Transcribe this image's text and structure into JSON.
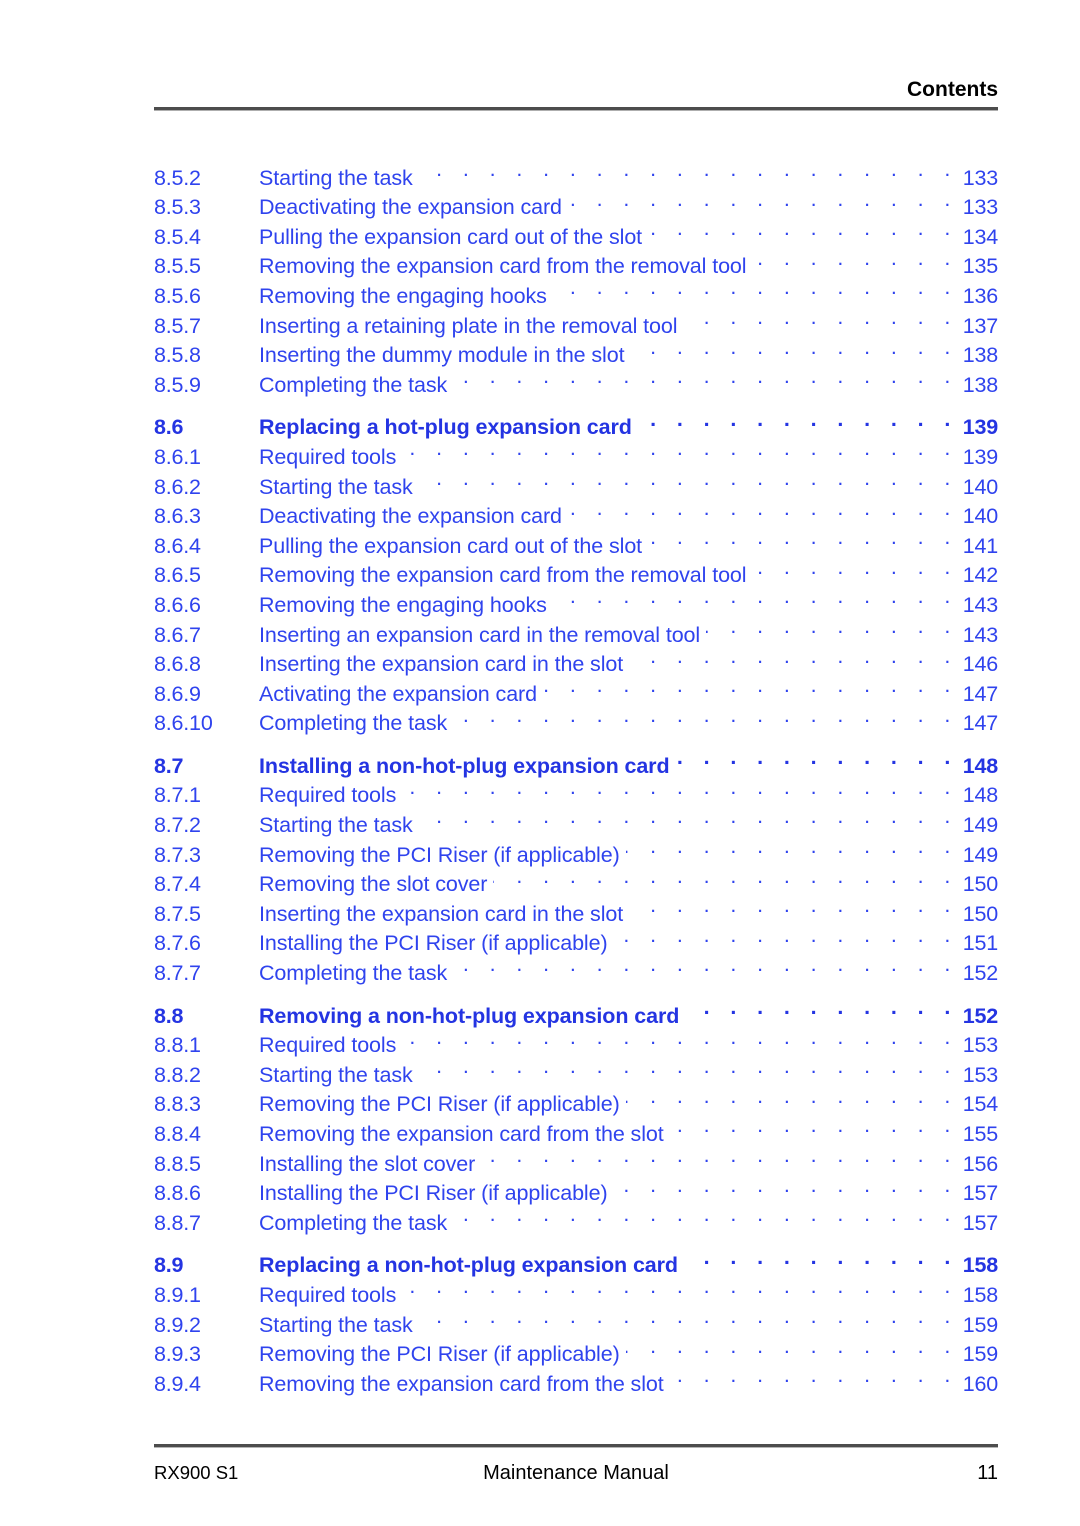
{
  "header": {
    "title": "Contents"
  },
  "toc": {
    "entries": [
      {
        "num": "8.5.2",
        "title": "Starting the task",
        "page": "133",
        "level": "sub"
      },
      {
        "num": "8.5.3",
        "title": "Deactivating the expansion card",
        "page": "133",
        "level": "sub"
      },
      {
        "num": "8.5.4",
        "title": "Pulling the expansion card out of the slot",
        "page": "134",
        "level": "sub"
      },
      {
        "num": "8.5.5",
        "title": "Removing the expansion card from the removal tool",
        "page": "135",
        "level": "sub"
      },
      {
        "num": "8.5.6",
        "title": "Removing the engaging hooks",
        "page": "136",
        "level": "sub"
      },
      {
        "num": "8.5.7",
        "title": "Inserting a retaining plate in the removal tool",
        "page": "137",
        "level": "sub"
      },
      {
        "num": "8.5.8",
        "title": "Inserting the dummy module in the slot",
        "page": "138",
        "level": "sub"
      },
      {
        "num": "8.5.9",
        "title": "Completing the task",
        "page": "138",
        "level": "sub"
      },
      {
        "num": "8.6",
        "title": "Replacing a hot-plug expansion card",
        "page": "139",
        "level": "section"
      },
      {
        "num": "8.6.1",
        "title": "Required tools",
        "page": "139",
        "level": "sub"
      },
      {
        "num": "8.6.2",
        "title": "Starting the task",
        "page": "140",
        "level": "sub"
      },
      {
        "num": "8.6.3",
        "title": "Deactivating the expansion card",
        "page": "140",
        "level": "sub"
      },
      {
        "num": "8.6.4",
        "title": "Pulling the expansion card out of the slot",
        "page": "141",
        "level": "sub"
      },
      {
        "num": "8.6.5",
        "title": "Removing the expansion card from the removal tool",
        "page": "142",
        "level": "sub"
      },
      {
        "num": "8.6.6",
        "title": "Removing the engaging hooks",
        "page": "143",
        "level": "sub"
      },
      {
        "num": "8.6.7",
        "title": "Inserting an expansion card in the removal tool",
        "page": "143",
        "level": "sub"
      },
      {
        "num": "8.6.8",
        "title": "Inserting the expansion card in the slot",
        "page": "146",
        "level": "sub"
      },
      {
        "num": "8.6.9",
        "title": "Activating the expansion card",
        "page": "147",
        "level": "sub"
      },
      {
        "num": "8.6.10",
        "title": "Completing the task",
        "page": "147",
        "level": "sub"
      },
      {
        "num": "8.7",
        "title": "Installing a non-hot-plug expansion card",
        "page": "148",
        "level": "section"
      },
      {
        "num": "8.7.1",
        "title": "Required tools",
        "page": "148",
        "level": "sub"
      },
      {
        "num": "8.7.2",
        "title": "Starting the task",
        "page": "149",
        "level": "sub"
      },
      {
        "num": "8.7.3",
        "title": "Removing the PCI Riser (if applicable)",
        "page": "149",
        "level": "sub"
      },
      {
        "num": "8.7.4",
        "title": "Removing the slot cover",
        "page": "150",
        "level": "sub"
      },
      {
        "num": "8.7.5",
        "title": "Inserting the expansion card in the slot",
        "page": "150",
        "level": "sub"
      },
      {
        "num": "8.7.6",
        "title": "Installing the PCI Riser (if applicable)",
        "page": "151",
        "level": "sub"
      },
      {
        "num": "8.7.7",
        "title": "Completing the task",
        "page": "152",
        "level": "sub"
      },
      {
        "num": "8.8",
        "title": "Removing a non-hot-plug expansion card",
        "page": "152",
        "level": "section"
      },
      {
        "num": "8.8.1",
        "title": "Required tools",
        "page": "153",
        "level": "sub"
      },
      {
        "num": "8.8.2",
        "title": "Starting the task",
        "page": "153",
        "level": "sub"
      },
      {
        "num": "8.8.3",
        "title": "Removing the PCI Riser (if applicable)",
        "page": "154",
        "level": "sub"
      },
      {
        "num": "8.8.4",
        "title": "Removing the expansion card from the slot",
        "page": "155",
        "level": "sub"
      },
      {
        "num": "8.8.5",
        "title": "Installing the slot cover",
        "page": "156",
        "level": "sub"
      },
      {
        "num": "8.8.6",
        "title": "Installing the PCI Riser (if applicable)",
        "page": "157",
        "level": "sub"
      },
      {
        "num": "8.8.7",
        "title": "Completing the task",
        "page": "157",
        "level": "sub"
      },
      {
        "num": "8.9",
        "title": "Replacing a non-hot-plug expansion card",
        "page": "158",
        "level": "section"
      },
      {
        "num": "8.9.1",
        "title": "Required tools",
        "page": "158",
        "level": "sub"
      },
      {
        "num": "8.9.2",
        "title": "Starting the task",
        "page": "159",
        "level": "sub"
      },
      {
        "num": "8.9.3",
        "title": "Removing the PCI Riser (if applicable)",
        "page": "159",
        "level": "sub"
      },
      {
        "num": "8.9.4",
        "title": "Removing the expansion card from the slot",
        "page": "160",
        "level": "sub"
      }
    ]
  },
  "footer": {
    "product": "RX900 S1",
    "document_title": "Maintenance Manual",
    "page_number": "11"
  },
  "colors": {
    "link_blue": "#2f43ee",
    "section_blue": "#2434e2",
    "rule_gray": "#4d4d4d",
    "text_black": "#000000",
    "page_background": "#ffffff"
  }
}
